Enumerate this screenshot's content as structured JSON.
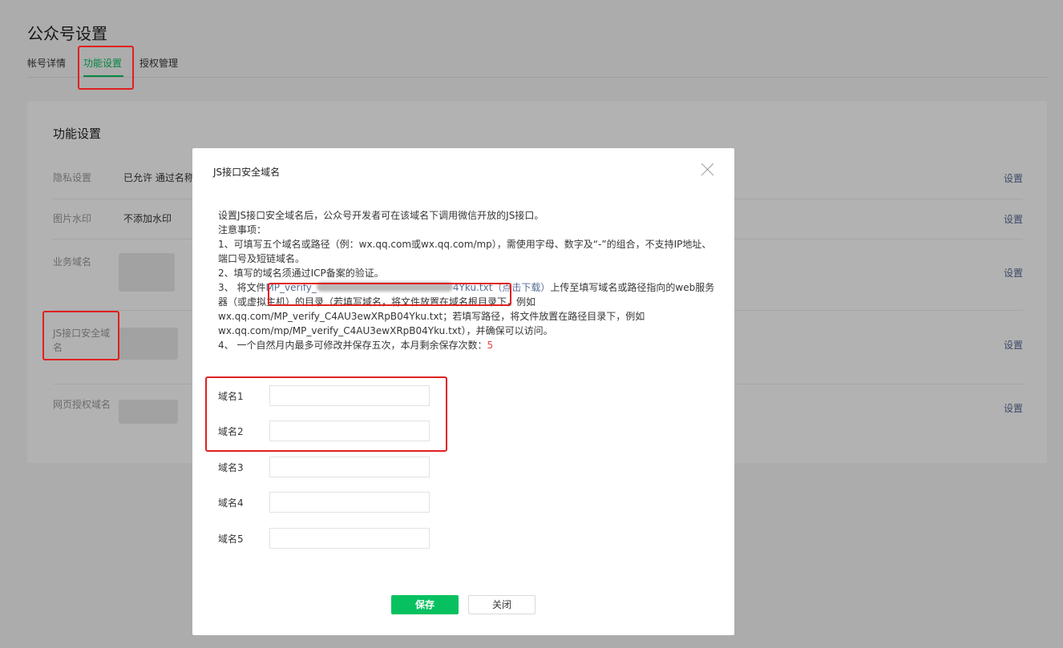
{
  "page": {
    "title": "公众号设置",
    "tabs": [
      "帐号详情",
      "功能设置",
      "授权管理"
    ]
  },
  "card": {
    "title": "功能设置",
    "rows": [
      {
        "label": "隐私设置",
        "value": "已允许 通过名称",
        "action": "设置"
      },
      {
        "label": "图片水印",
        "value": "不添加水印",
        "action": "设置"
      },
      {
        "label": "业务域名",
        "action": "设置"
      },
      {
        "label": "JS接口安全域名",
        "action": "设置"
      },
      {
        "label": "网页授权域名",
        "action": "设置"
      }
    ]
  },
  "dialog": {
    "title": "JS接口安全域名",
    "intro": "设置JS接口安全域名后，公众号开发者可在该域名下调用微信开放的JS接口。",
    "notes_label": "注意事项：",
    "note1": "1、可填写五个域名或路径（例：wx.qq.com或wx.qq.com/mp），需使用字母、数字及“-”的组合，不支持IP地址、端口号及短链域名。",
    "note2": "2、填写的域名须通过ICP备案的验证。",
    "note3_prefix": "3、 将文件",
    "note3_link_start": "MP_verify_",
    "note3_link_end": "4Yku.txt（点击下载）",
    "note3_rest": "上传至填写域名或路径指向的web服务器（或虚拟主机）的目录（若填写域名，将文件放置在域名根目录下，例如wx.qq.com/MP_verify_C4AU3ewXRpB04Yku.txt；若填写路径，将文件放置在路径目录下，例如wx.qq.com/mp/MP_verify_C4AU3ewXRpB04Yku.txt），并确保可以访问。",
    "note4_prefix": "4、 一个自然月内最多可修改并保存五次，本月剩余保存次数：",
    "note4_count": "5",
    "fields": [
      {
        "label": "域名1",
        "value": ""
      },
      {
        "label": "域名2",
        "value": ""
      },
      {
        "label": "域名3",
        "value": ""
      },
      {
        "label": "域名4",
        "value": ""
      },
      {
        "label": "域名5",
        "value": ""
      }
    ],
    "save_label": "保存",
    "close_label": "关闭"
  },
  "colors": {
    "accent": "#07c160",
    "link": "#576b95",
    "highlight": "#e02020",
    "count": "#e64340"
  }
}
